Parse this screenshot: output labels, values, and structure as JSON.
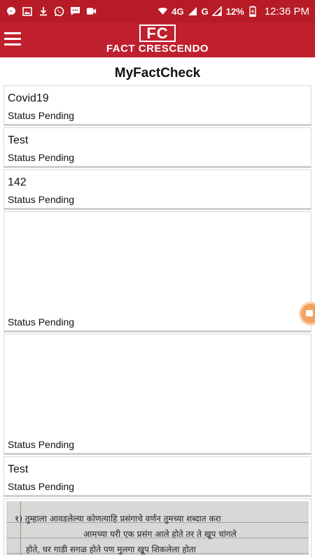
{
  "status_bar": {
    "icons_left": [
      "messenger-icon",
      "image-icon",
      "download-icon",
      "whatsapp-icon",
      "chat-icon",
      "video-icon"
    ],
    "network_label": "4G",
    "network_label_2": "G",
    "battery": "12%",
    "time": "12:36 PM"
  },
  "app_bar": {
    "logo_mark": "FC",
    "logo_text": "FACT CRESCENDO"
  },
  "page": {
    "title": "MyFactCheck"
  },
  "items": [
    {
      "title": "Covid19",
      "status_label": "Status",
      "status_value": "Pending"
    },
    {
      "title": "Test",
      "status_label": "Status",
      "status_value": "Pending"
    },
    {
      "title": "142",
      "status_label": "Status",
      "status_value": "Pending"
    },
    {
      "title": "",
      "status_label": "Status",
      "status_value": "Pending"
    },
    {
      "title": "",
      "status_label": "Status",
      "status_value": "Pending"
    },
    {
      "title": "Test",
      "status_label": "Status",
      "status_value": "Pending"
    }
  ],
  "image_item": {
    "line1": "१) तुम्हाला आवडलेल्या कोणत्याहि प्रसंगाचे वर्णन तुमच्या शब्दात करा",
    "line2": "आमच्या घरी एक प्रसंग आले होते तर ते खूप चांगले",
    "line3": "होते, घर गाडी सगळ होते पण मुलगा खूप शिकलेला होता"
  },
  "colors": {
    "brand_red": "#c0202d",
    "status_bar": "#b71c26"
  }
}
